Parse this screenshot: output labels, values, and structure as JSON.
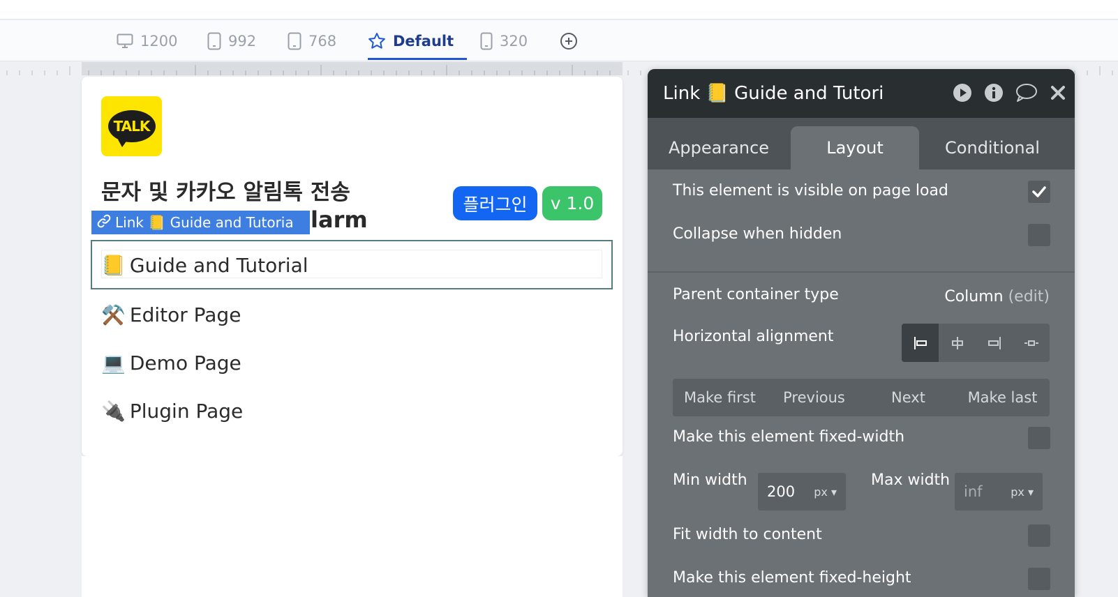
{
  "breakpoints": [
    {
      "label": "1200",
      "icon": "desktop-icon"
    },
    {
      "label": "992",
      "icon": "tablet-icon"
    },
    {
      "label": "768",
      "icon": "tablet-icon"
    },
    {
      "label": "Default",
      "icon": "star-icon",
      "active": true
    },
    {
      "label": "320",
      "icon": "phone-icon"
    }
  ],
  "canvas": {
    "logo_text": "TALK",
    "title_line1": "문자 및 카카오 알림톡 전송",
    "title_line2_tail": "larm",
    "selected_label": "Link 📒 Guide and Tutoria",
    "badge_plugin": "플러그인",
    "badge_version": "v 1.0",
    "nav": [
      {
        "emoji": "📒",
        "label": "Guide and Tutorial"
      },
      {
        "emoji": "⚒️",
        "label": "Editor Page"
      },
      {
        "emoji": "💻",
        "label": "Demo Page"
      },
      {
        "emoji": "🔌",
        "label": "Plugin Page"
      }
    ]
  },
  "panel": {
    "title": "Link 📒 Guide and Tutori",
    "tabs": [
      "Appearance",
      "Layout",
      "Conditional"
    ],
    "active_tab": "Layout",
    "visible_on_load": "This element is visible on page load",
    "collapse_hidden": "Collapse when hidden",
    "parent_type_label": "Parent container type",
    "parent_type_value": "Column",
    "parent_type_edit": "(edit)",
    "h_align_label": "Horizontal alignment",
    "order_buttons": [
      "Make first",
      "Previous",
      "Next",
      "Make last"
    ],
    "fixed_width": "Make this element fixed-width",
    "min_width_label": "Min width",
    "min_width_value": "200",
    "min_width_unit": "px",
    "max_width_label": "Max width",
    "max_width_placeholder": "inf",
    "max_width_unit": "px",
    "fit_width": "Fit width to content",
    "fixed_height": "Make this element fixed-height"
  },
  "colors": {
    "accent": "#1e56d6",
    "selection": "#3d7ee0",
    "badge_blue": "#1266f1",
    "badge_green": "#3cc46b",
    "kakao_yellow": "#fee500"
  }
}
